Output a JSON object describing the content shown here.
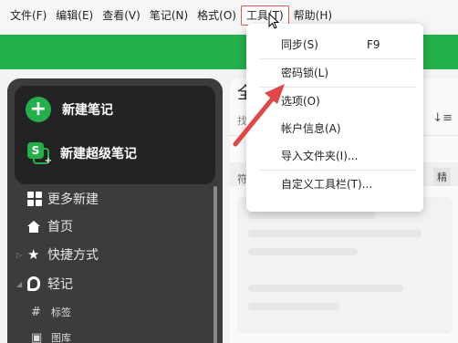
{
  "menubar": {
    "items": [
      "文件(F)",
      "编辑(E)",
      "查看(V)",
      "笔记(N)",
      "格式(O)",
      "工具(T)",
      "帮助(H)"
    ]
  },
  "sidebar": {
    "new_note": "新建笔记",
    "new_super_note": "新建超级笔记",
    "items": [
      {
        "label": "更多新建",
        "icon": "grid-icon"
      },
      {
        "label": "首页",
        "icon": "home-icon"
      },
      {
        "label": "快捷方式",
        "icon": "star-icon"
      },
      {
        "label": "轻记",
        "icon": "quick-note-icon"
      },
      {
        "label": "标签",
        "icon": "hash-icon"
      },
      {
        "label": "图库",
        "icon": "image-icon"
      }
    ]
  },
  "content": {
    "title_char": "全",
    "sub_char": "找",
    "filter_char": "符",
    "filter_right": "精"
  },
  "tools_menu": {
    "items": [
      {
        "label": "同步(S)",
        "shortcut": "F9"
      },
      {
        "label": "密码锁(L)"
      },
      {
        "label": "选项(O)"
      },
      {
        "label": "帐户信息(A)"
      },
      {
        "label": "导入文件夹(I)..."
      },
      {
        "label": "自定义工具栏(T)..."
      }
    ]
  },
  "colors": {
    "accent": "#23b04b",
    "sidebar_bg": "#3c3c3c",
    "annotation_arrow": "#e04848"
  }
}
